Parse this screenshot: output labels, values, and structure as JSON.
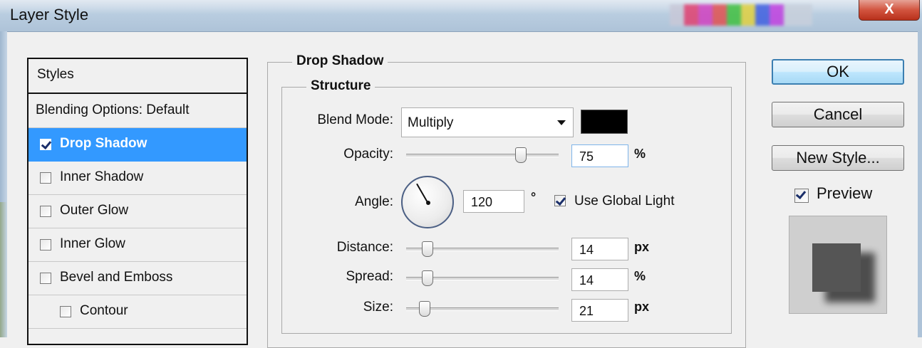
{
  "window": {
    "title": "Layer Style",
    "close_glyph": "X"
  },
  "styles_list": {
    "header": "Styles",
    "items": [
      {
        "label": "Blending Options: Default",
        "has_checkbox": false,
        "checked": false,
        "selected": false
      },
      {
        "label": "Drop Shadow",
        "has_checkbox": true,
        "checked": true,
        "selected": true
      },
      {
        "label": "Inner Shadow",
        "has_checkbox": true,
        "checked": false,
        "selected": false
      },
      {
        "label": "Outer Glow",
        "has_checkbox": true,
        "checked": false,
        "selected": false
      },
      {
        "label": "Inner Glow",
        "has_checkbox": true,
        "checked": false,
        "selected": false
      },
      {
        "label": "Bevel and Emboss",
        "has_checkbox": true,
        "checked": false,
        "selected": false
      },
      {
        "label": "Contour",
        "has_checkbox": true,
        "checked": false,
        "selected": false
      }
    ]
  },
  "drop_shadow": {
    "section_title": "Drop Shadow",
    "structure_title": "Structure",
    "blend_mode": {
      "label": "Blend Mode:",
      "value": "Multiply",
      "color": "#000000"
    },
    "opacity": {
      "label": "Opacity:",
      "value": "75",
      "unit": "%",
      "level": 0.75
    },
    "angle": {
      "label": "Angle:",
      "value": "120",
      "unit": "°",
      "degrees": 120
    },
    "use_global_light": {
      "label": "Use Global Light",
      "checked": true
    },
    "distance": {
      "label": "Distance:",
      "value": "14",
      "unit": "px",
      "level": 0.14
    },
    "spread": {
      "label": "Spread:",
      "value": "14",
      "unit": "%",
      "level": 0.14
    },
    "size": {
      "label": "Size:",
      "value": "21",
      "unit": "px",
      "level": 0.12
    }
  },
  "buttons": {
    "ok": "OK",
    "cancel": "Cancel",
    "new_style": "New Style..."
  },
  "preview": {
    "label": "Preview",
    "checked": true
  },
  "colors": {
    "selection": "#3399ff",
    "default_button_border": "#3c7fb1",
    "close_button": "#c9432e"
  }
}
